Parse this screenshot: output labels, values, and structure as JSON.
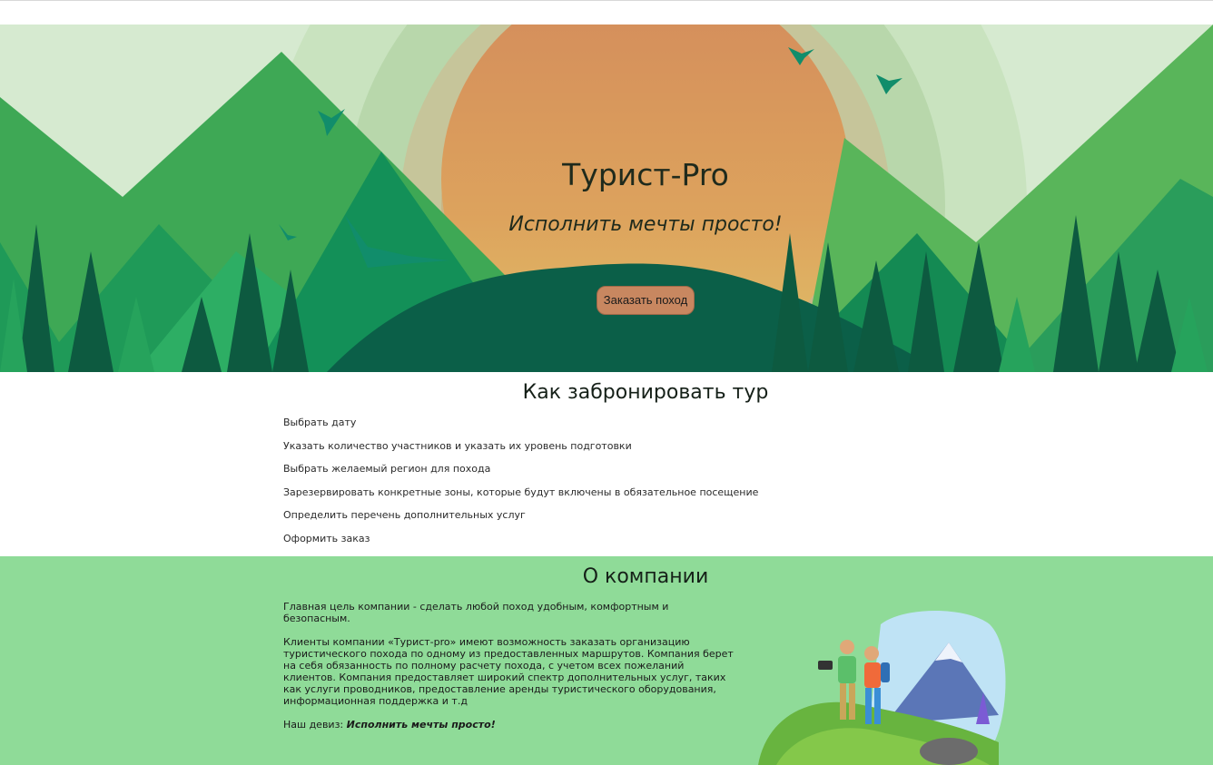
{
  "hero": {
    "title": "Турист-Pro",
    "subtitle": "Исполнить мечты просто!",
    "button_label": "Заказать поход"
  },
  "booking": {
    "heading": "Как забронировать тур",
    "steps": [
      "Выбрать дату",
      "Указать количество участников и указать их уровень подготовки",
      "Выбрать желаемый регион для похода",
      "Зарезервировать конкретные зоны, которые будут включены в обязательное посещение",
      "Определить перечень дополнительных услуг",
      "Оформить заказ"
    ]
  },
  "about": {
    "heading": "О компании",
    "paragraph1": "Главная цель компании - сделать любой поход удобным, комфортным и безопасным.",
    "paragraph2": "Клиенты компании «Турист-pro» имеют возможность заказать организацию туристического похода по одному из предоставленных маршрутов. Компания берет на себя обязанность по полному расчету похода, с учетом всех пожеланий клиентов. Компания предоставляет широкий спектр дополнительных услуг, таких как услуги проводников, предоставление аренды туристического оборудования, информационная поддержка и т.д",
    "motto_label": "Наш девиз: ",
    "motto_value": "Исполнить мечты просто!"
  },
  "colors": {
    "about_background": "#8fdb98",
    "button_background": "#c88760",
    "forest_dark": "#0b5f48",
    "forest_light": "#22a464"
  }
}
